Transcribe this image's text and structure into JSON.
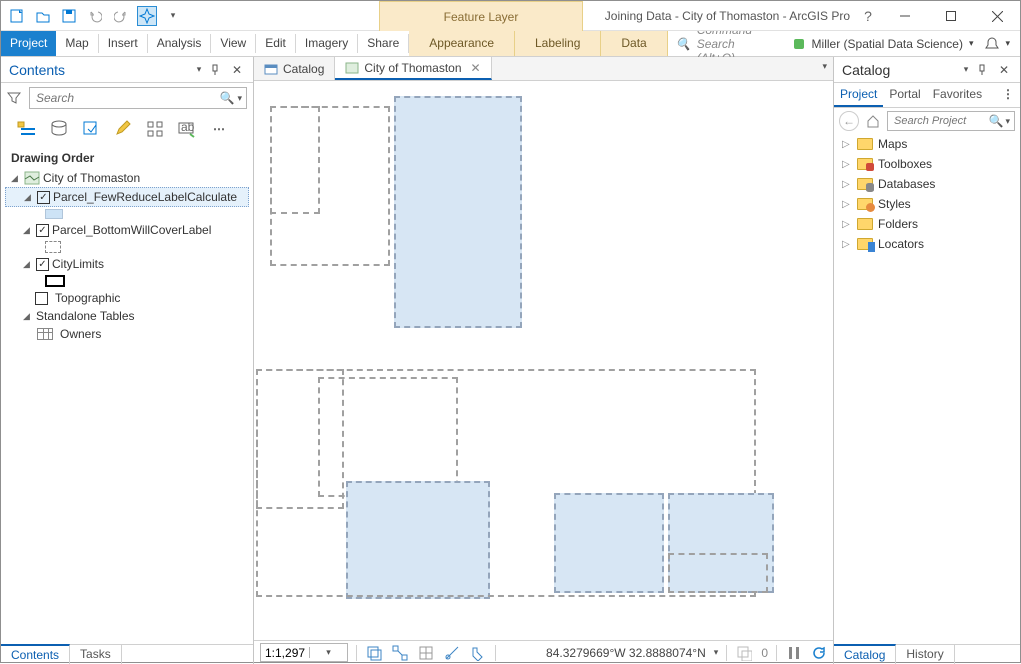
{
  "titlebar": {
    "feature_layer_tab": "Feature Layer",
    "window_title": "Joining Data - City of Thomaston - ArcGIS Pro"
  },
  "ribbon": {
    "tabs": [
      "Project",
      "Map",
      "Insert",
      "Analysis",
      "View",
      "Edit",
      "Imagery",
      "Share"
    ],
    "ctx_tabs": [
      "Appearance",
      "Labeling",
      "Data"
    ],
    "command_search_placeholder": "Command Search (Alt+Q)",
    "user": "Miller (Spatial Data Science)"
  },
  "contents": {
    "title": "Contents",
    "search_placeholder": "Search",
    "drawing_order": "Drawing Order",
    "map_name": "City of Thomaston",
    "layers": [
      {
        "name": "Parcel_FewReduceLabelCalculate",
        "checked": true,
        "selected": true,
        "symbol": "blue-fill"
      },
      {
        "name": "Parcel_BottomWillCoverLabel",
        "checked": true,
        "symbol": "dashed"
      },
      {
        "name": "CityLimits",
        "checked": true,
        "symbol": "black-rect"
      },
      {
        "name": "Topographic",
        "checked": false,
        "symbol": "none"
      }
    ],
    "standalone_header": "Standalone Tables",
    "standalone_tables": [
      "Owners"
    ],
    "footer_tabs": [
      "Contents",
      "Tasks"
    ]
  },
  "view_tabs": {
    "tabs": [
      {
        "label": "Catalog",
        "active": false
      },
      {
        "label": "City of Thomaston",
        "active": true,
        "closable": true
      }
    ]
  },
  "status_bar": {
    "scale": "1:1,297",
    "coords": "84.3279669°W 32.8888074°N",
    "selection_count": "0"
  },
  "catalog": {
    "title": "Catalog",
    "tabs": [
      "Project",
      "Portal",
      "Favorites"
    ],
    "search_placeholder": "Search Project",
    "items": [
      "Maps",
      "Toolboxes",
      "Databases",
      "Styles",
      "Folders",
      "Locators"
    ],
    "footer_tabs": [
      "Catalog",
      "History"
    ]
  }
}
